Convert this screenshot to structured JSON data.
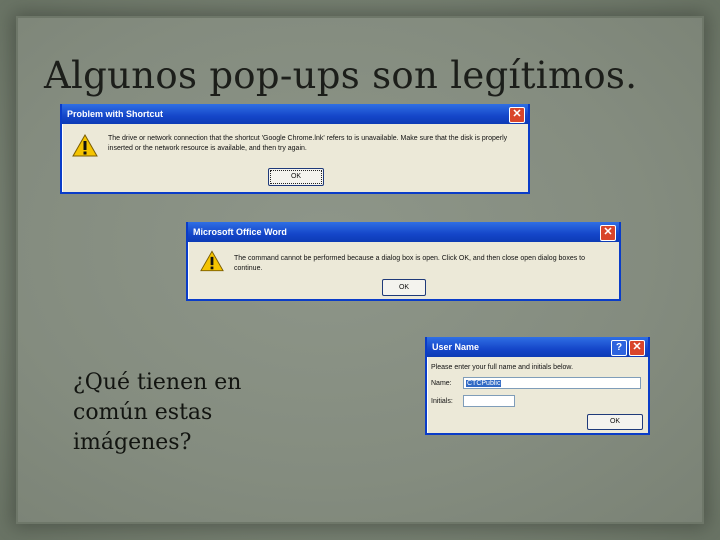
{
  "slide": {
    "title": "Algunos pop-ups son legítimos.",
    "question_lines": [
      "¿Qué tienen en",
      "común estas",
      "imágenes?"
    ]
  },
  "dialogs": {
    "shortcut_problem": {
      "title": "Problem with Shortcut",
      "message": "The drive or network connection that the shortcut 'Google Chrome.lnk' refers to is unavailable. Make sure that the disk is properly inserted or the network resource is available, and then try again.",
      "ok_label": "OK",
      "close_symbol": "✕",
      "icon": "warning-icon"
    },
    "word_error": {
      "title": "Microsoft Office Word",
      "message": "The command cannot be performed because a dialog box is open. Click OK, and then close open dialog boxes to continue.",
      "ok_label": "OK",
      "close_symbol": "✕",
      "icon": "warning-icon"
    },
    "user_name": {
      "title": "User Name",
      "message": "Please enter your full name and initials below.",
      "name_label": "Name:",
      "name_value": "CTCPublic",
      "initials_label": "Initials:",
      "initials_value": "",
      "ok_label": "OK",
      "help_symbol": "?",
      "close_symbol": "✕"
    }
  },
  "colors": {
    "titlebar": "#1546c9",
    "dialog_bg": "#ece9d8",
    "close_button": "#d9452b",
    "warning_yellow": "#f5c400"
  }
}
